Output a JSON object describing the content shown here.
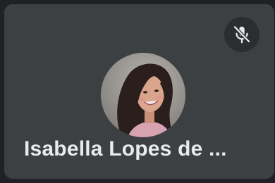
{
  "participant": {
    "name": "Isabella Lopes de ...",
    "mic_icon": "mic-off-icon",
    "mic_state": "muted"
  },
  "colors": {
    "background": "#202124",
    "tile": "#3c4043",
    "mic_button": "#2b2e31",
    "name_text": "#e8eaed"
  }
}
